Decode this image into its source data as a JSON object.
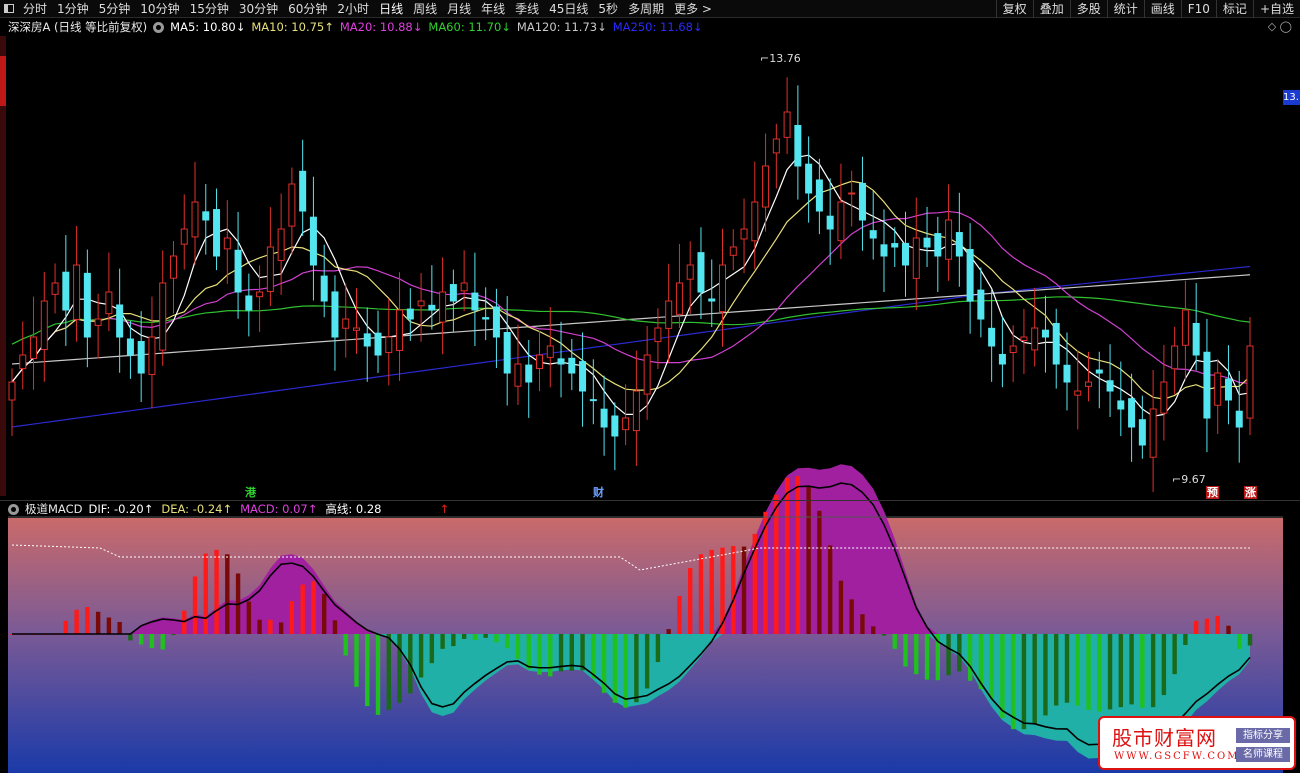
{
  "toolbar": {
    "periods": [
      "分时",
      "1分钟",
      "5分钟",
      "10分钟",
      "15分钟",
      "30分钟",
      "60分钟",
      "2小时",
      "日线",
      "周线",
      "月线",
      "年线",
      "季线",
      "45日线",
      "5秒",
      "多周期",
      "更多 >"
    ],
    "active_period": "日线",
    "right_tools": [
      "复权",
      "叠加",
      "多股",
      "统计",
      "画线",
      "F10",
      "标记",
      "+自选"
    ]
  },
  "main": {
    "stock_title": "深深房A (日线 等比前复权)",
    "ma_labels": [
      {
        "text": "MA5: 10.80↓",
        "color": "#ffffff"
      },
      {
        "text": "MA10: 10.75↑",
        "color": "#e8e07a"
      },
      {
        "text": "MA20: 10.88↓",
        "color": "#e040e0"
      },
      {
        "text": "MA60: 11.70↓",
        "color": "#30d030"
      },
      {
        "text": "MA120: 11.73↓",
        "color": "#c8c8c8"
      },
      {
        "text": "MA250: 11.68↓",
        "color": "#2a2aff"
      }
    ],
    "high_label": "13.76",
    "low_label": "9.67",
    "price_tag": "13.",
    "markers": {
      "gang": "港",
      "cai": "财",
      "yu": "预",
      "zhang": "涨"
    },
    "tool_icons": "◇ ◯"
  },
  "sub": {
    "indicator": "极道MACD",
    "values": [
      {
        "text": "DIF: -0.20↑",
        "color": "#ffffff"
      },
      {
        "text": "DEA: -0.24↑",
        "color": "#e8e07a"
      },
      {
        "text": "MACD: 0.07↑",
        "color": "#e040e0"
      },
      {
        "text": "高线: 0.28",
        "color": "#ffffff"
      }
    ],
    "arrow_mark": "↑"
  },
  "watermark": {
    "title": "股市财富网",
    "url": "WWW.GSCFW.COM",
    "tag1": "指标分享",
    "tag2": "名师课程"
  },
  "colors": {
    "up": "#e0302a",
    "down": "#54e6f0",
    "ma5": "#ffffff",
    "ma10": "#e8e07a",
    "ma20": "#d040d0",
    "ma60": "#30c030",
    "ma120": "#c8c8c8",
    "ma250": "#2a2ad0"
  },
  "chart_data": {
    "type": "candlestick",
    "period": "日线",
    "ylim": [
      9.3,
      14.3
    ],
    "closes": [
      10.5,
      10.8,
      11.0,
      11.4,
      11.6,
      11.3,
      11.8,
      11.0,
      11.2,
      11.5,
      11.0,
      10.8,
      10.6,
      11.0,
      11.6,
      11.9,
      12.2,
      12.5,
      12.3,
      11.9,
      12.1,
      11.5,
      11.3,
      11.5,
      12.0,
      12.2,
      12.7,
      12.4,
      11.8,
      11.4,
      11.0,
      11.2,
      11.1,
      10.9,
      10.8,
      11.0,
      11.3,
      11.2,
      11.4,
      11.3,
      11.5,
      11.4,
      11.6,
      11.3,
      11.2,
      11.0,
      10.6,
      10.7,
      10.5,
      10.8,
      10.9,
      10.7,
      10.6,
      10.4,
      10.3,
      10.0,
      9.9,
      10.1,
      10.4,
      10.8,
      11.1,
      11.4,
      11.6,
      11.8,
      11.5,
      11.4,
      11.8,
      12.0,
      12.2,
      12.5,
      12.9,
      13.2,
      13.5,
      12.9,
      12.6,
      12.4,
      12.2,
      12.5,
      12.6,
      12.3,
      12.1,
      11.9,
      12.0,
      11.8,
      12.1,
      12.0,
      11.9,
      12.3,
      11.9,
      11.4,
      11.2,
      10.9,
      10.7,
      10.9,
      11.0,
      11.1,
      11.0,
      10.7,
      10.5,
      10.4,
      10.5,
      10.6,
      10.4,
      10.2,
      10.0,
      9.8,
      10.2,
      10.5,
      10.9,
      11.3,
      10.8,
      10.1,
      10.6,
      10.3,
      10.0,
      10.9
    ]
  }
}
